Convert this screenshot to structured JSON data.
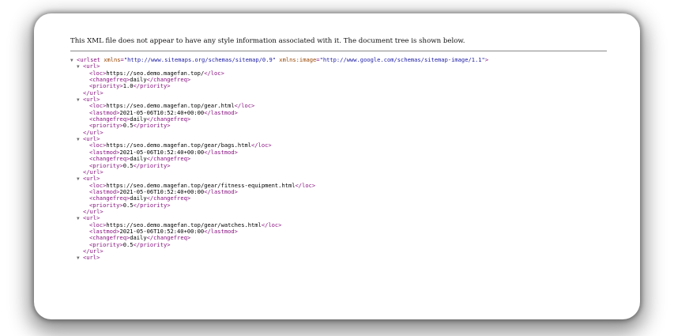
{
  "notice": "This XML file does not appear to have any style information associated with it. The document tree is shown below.",
  "colors": {
    "tag": "#881280",
    "attribute_name": "#994500",
    "attribute_value": "#1a1aa6",
    "text": "#000000"
  },
  "icons": {
    "expanded_toggle": "triangle-down-icon"
  },
  "root": {
    "open": "<urlset",
    "attrs": [
      {
        "name": "xmlns",
        "value": "\"http://www.sitemaps.org/schemas/sitemap/0.9\""
      },
      {
        "name": "xmlns:image",
        "value": "\"http://www.google.com/schemas/sitemap-image/1.1\""
      }
    ],
    "open_end": ">"
  },
  "urls": [
    {
      "loc": "https://seo.demo.magefan.top/",
      "lastmod": null,
      "changefreq": "daily",
      "priority": "1.0"
    },
    {
      "loc": "https://seo.demo.magefan.top/gear.html",
      "lastmod": "2021-05-06T10:52:40+00:00",
      "changefreq": "daily",
      "priority": "0.5"
    },
    {
      "loc": "https://seo.demo.magefan.top/gear/bags.html",
      "lastmod": "2021-05-06T10:52:40+00:00",
      "changefreq": "daily",
      "priority": "0.5"
    },
    {
      "loc": "https://seo.demo.magefan.top/gear/fitness-equipment.html",
      "lastmod": "2021-05-06T10:52:40+00:00",
      "changefreq": "daily",
      "priority": "0.5"
    },
    {
      "loc": "https://seo.demo.magefan.top/gear/watches.html",
      "lastmod": "2021-05-06T10:52:40+00:00",
      "changefreq": "daily",
      "priority": "0.5"
    }
  ],
  "last_open_url": "<url>"
}
